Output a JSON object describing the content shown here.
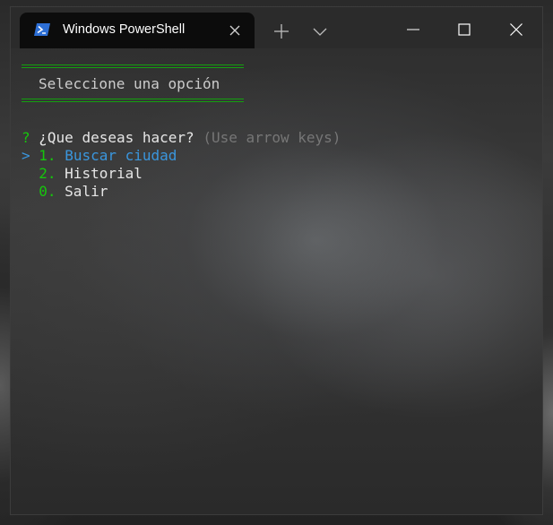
{
  "window": {
    "tab_title": "Windows PowerShell",
    "tab_icon": "powershell-icon",
    "controls": [
      "new-tab-icon",
      "dropdown-chevron-icon",
      "minimize-icon",
      "maximize-icon",
      "close-icon"
    ]
  },
  "terminal": {
    "heading": "Seleccione una opción",
    "prompt_mark": "?",
    "question": "¿Que deseas hacer?",
    "hint": "(Use arrow keys)",
    "pointer": ">",
    "options": [
      {
        "number": "1.",
        "label": "Buscar ciudad",
        "selected": true
      },
      {
        "number": "2.",
        "label": "Historial",
        "selected": false
      },
      {
        "number": "0.",
        "label": "Salir",
        "selected": false
      }
    ]
  },
  "colors": {
    "accent_green": "#16c60c",
    "selected_cyan": "#3a96dd",
    "hint_gray": "#767676",
    "text": "#cccccc"
  }
}
